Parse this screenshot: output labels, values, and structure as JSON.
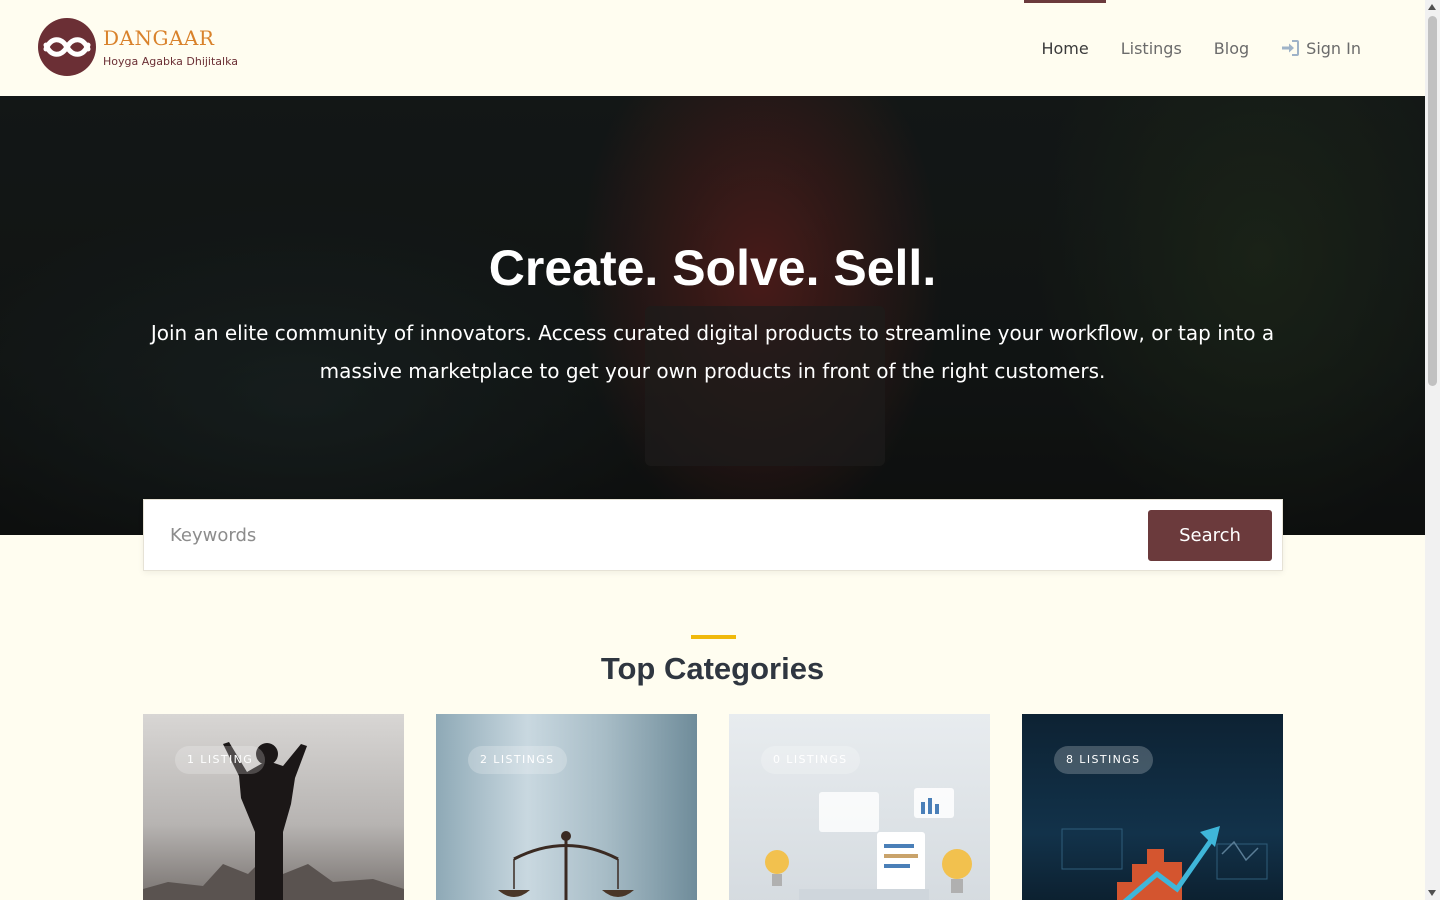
{
  "brand": {
    "name": "DANGAAR",
    "tagline": "Hoyga Agabka Dhijitalka",
    "logo_icon": "infinity-logo-icon",
    "colors": {
      "primary": "#6b3a3c",
      "accent": "#d9822b",
      "highlight": "#f0b90b"
    }
  },
  "nav": {
    "home": "Home",
    "listings": "Listings",
    "blog": "Blog",
    "signin": "Sign In",
    "signin_icon": "sign-in-icon",
    "active": "Home"
  },
  "hero": {
    "title": "Create. Solve. Sell.",
    "subtitle": "Join an elite community of innovators. Access curated digital products to streamline your workflow, or tap into a massive marketplace to get your own products in front of the right customers."
  },
  "search": {
    "placeholder": "Keywords",
    "value": "",
    "button_label": "Search"
  },
  "categories": {
    "title": "Top Categories",
    "items": [
      {
        "badge": "1 LISTING"
      },
      {
        "badge": "2 LISTINGS"
      },
      {
        "badge": "0 LISTINGS"
      },
      {
        "badge": "8 LISTINGS"
      }
    ]
  }
}
